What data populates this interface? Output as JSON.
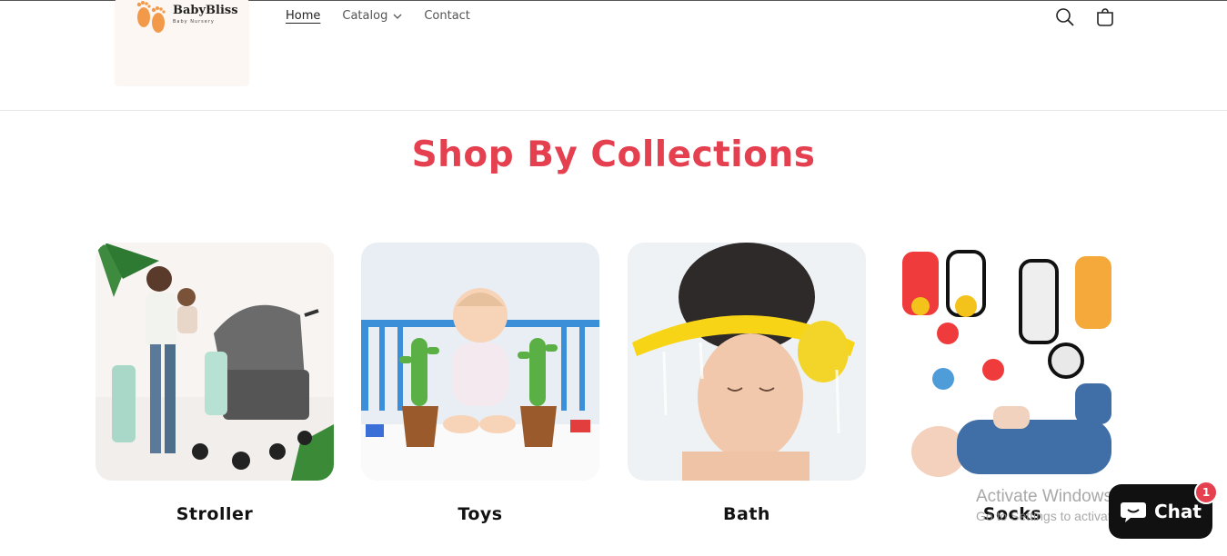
{
  "brand": {
    "name": "BabyBliss",
    "tagline": "Baby Nursery"
  },
  "nav": {
    "home": "Home",
    "catalog": "Catalog",
    "contact": "Contact"
  },
  "header_icons": {
    "search": "search-icon",
    "cart": "cart-icon"
  },
  "section": {
    "title": "Shop By Collections"
  },
  "collections": [
    {
      "label": "Stroller",
      "icon": "stroller-image"
    },
    {
      "label": "Toys",
      "icon": "toys-image"
    },
    {
      "label": "Bath",
      "icon": "bath-image"
    },
    {
      "label": "Socks",
      "icon": "socks-image"
    }
  ],
  "watermark": {
    "title": "Activate Windows",
    "subtitle": "Go to Settings to activate Windows."
  },
  "chat": {
    "label": "Chat",
    "badge": "1"
  },
  "colors": {
    "accent": "#e5404f",
    "chat_bg": "#111111"
  }
}
